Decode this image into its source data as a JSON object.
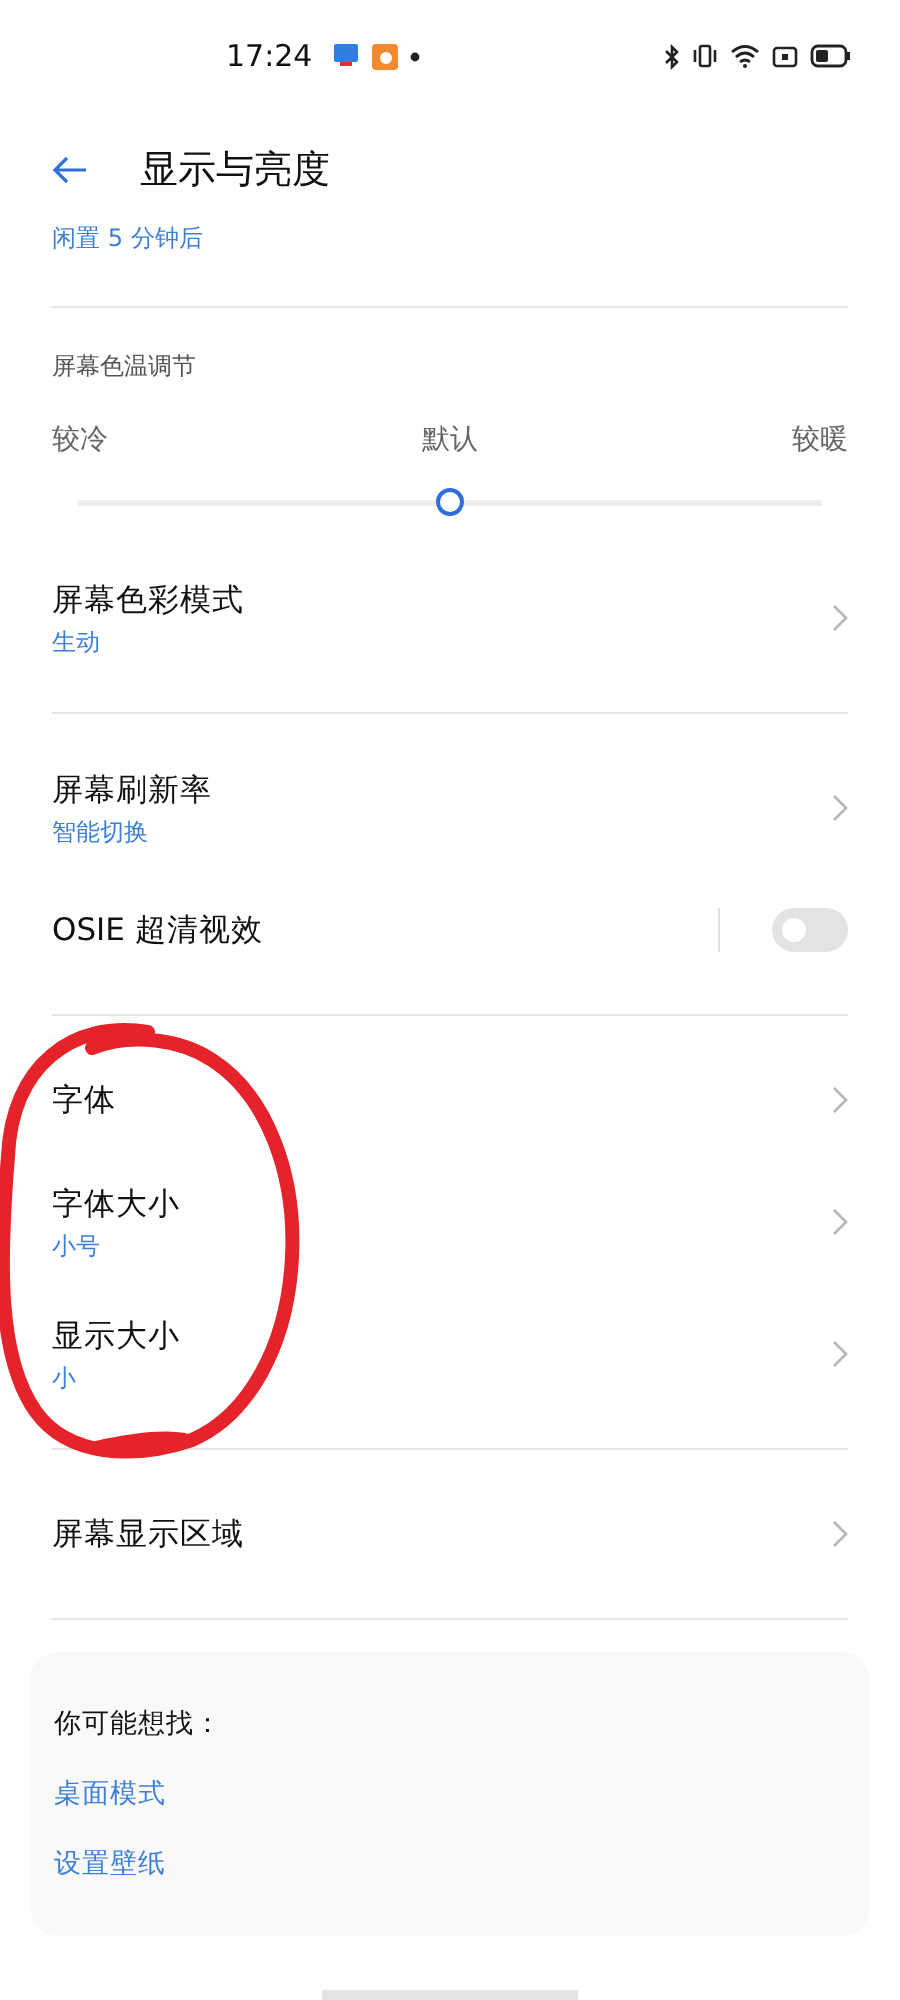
{
  "status_bar": {
    "time": "17:24"
  },
  "header": {
    "title": "显示与亮度"
  },
  "previous_item": {
    "subtitle": "闲置 5 分钟后"
  },
  "color_temperature": {
    "title": "屏幕色温调节",
    "labels": [
      "较冷",
      "默认",
      "较暖"
    ],
    "level": 0.5
  },
  "groups": [
    [
      {
        "kind": "nav",
        "title": "屏幕色彩模式",
        "subtitle": "生动"
      }
    ],
    [
      {
        "kind": "nav",
        "title": "屏幕刷新率",
        "subtitle": "智能切换"
      },
      {
        "kind": "toggle",
        "title": "OSIE 超清视效",
        "on": false
      }
    ],
    [
      {
        "kind": "nav",
        "title": "字体"
      },
      {
        "kind": "nav",
        "title": "字体大小",
        "subtitle": "小号"
      },
      {
        "kind": "nav",
        "title": "显示大小",
        "subtitle": "小"
      }
    ],
    [
      {
        "kind": "nav",
        "title": "屏幕显示区域"
      }
    ]
  ],
  "suggestions": {
    "title": "你可能想找：",
    "links": [
      "桌面模式",
      "设置壁纸"
    ]
  },
  "annotation": {
    "kind": "hand-drawn-circle"
  }
}
